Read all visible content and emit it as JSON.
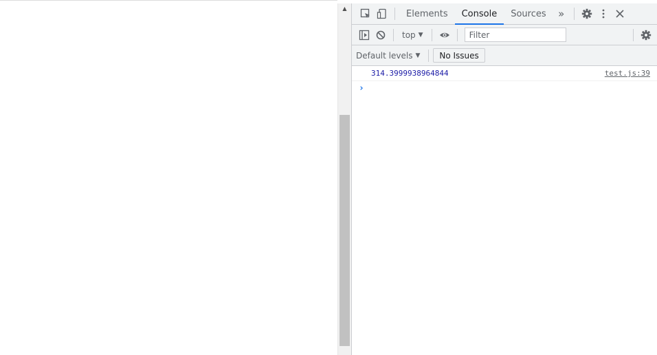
{
  "devtools": {
    "tabs": [
      {
        "label": "Elements",
        "active": false
      },
      {
        "label": "Console",
        "active": true
      },
      {
        "label": "Sources",
        "active": false
      }
    ],
    "more_tabs_glyph": "»",
    "icons": {
      "inspect": "inspect-element-icon",
      "device": "device-toolbar-icon",
      "settings": "gear-icon",
      "menu": "more-vertical-icon",
      "close": "close-icon"
    }
  },
  "console_toolbar": {
    "context_label": "top",
    "filter_placeholder": "Filter",
    "levels_label": "Default levels",
    "issues_label": "No Issues"
  },
  "console": {
    "messages": [
      {
        "value": "314.3999938964844",
        "source": "test.js:39"
      }
    ],
    "prompt_glyph": "›"
  },
  "colors": {
    "accent": "#1a73e8",
    "log_number": "#1a1aa6",
    "panel_bg": "#f1f3f4"
  }
}
